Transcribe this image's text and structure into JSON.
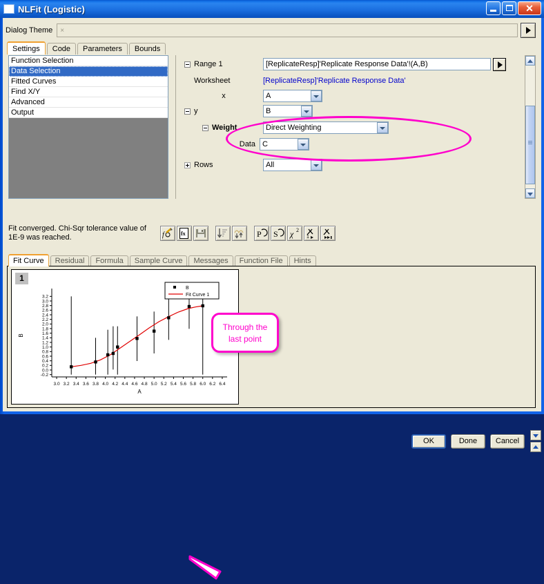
{
  "window": {
    "title": "NLFit (Logistic)",
    "minimize": "minimize",
    "maximize": "maximize",
    "close": "✕"
  },
  "theme": {
    "label": "Dialog Theme",
    "value": "",
    "placeholder": "×"
  },
  "top_tabs": [
    {
      "label": "Settings",
      "active": true
    },
    {
      "label": "Code",
      "active": false
    },
    {
      "label": "Parameters",
      "active": false
    },
    {
      "label": "Bounds",
      "active": false
    }
  ],
  "tree": {
    "items": [
      {
        "label": "Function Selection",
        "selected": false
      },
      {
        "label": "Data Selection",
        "selected": true
      },
      {
        "label": "Fitted Curves",
        "selected": false
      },
      {
        "label": "Find X/Y",
        "selected": false
      },
      {
        "label": "Advanced",
        "selected": false
      },
      {
        "label": "Output",
        "selected": false
      }
    ]
  },
  "settings": {
    "range_label": "Range 1",
    "range_value": "[ReplicateResp]'Replicate Response Data'!(A,B)",
    "worksheet_label": "Worksheet",
    "worksheet_value": "[ReplicateResp]'Replicate Response Data'",
    "x_label": "x",
    "x_value": "A",
    "y_label": "y",
    "y_value": "B",
    "weight_label": "Weight",
    "weight_value": "Direct Weighting",
    "data_label": "Data",
    "data_value": "C",
    "rows_label": "Rows",
    "rows_value": "All"
  },
  "status": {
    "text": "Fit converged. Chi-Sqr tolerance value of 1E-9 was reached."
  },
  "toolbar": {
    "buttons": [
      {
        "name": "formula-edit-icon",
        "glyph": "fℒ"
      },
      {
        "name": "function-file-icon",
        "glyph": "fx"
      },
      {
        "name": "save-icon",
        "glyph": "Ὃe"
      },
      {
        "name": "sort-descending-icon",
        "glyph": "↓"
      },
      {
        "name": "fit-peaks-icon",
        "glyph": "⇅"
      },
      {
        "name": "initialize-parameters-icon",
        "glyph": "P"
      },
      {
        "name": "simulate-curve-icon",
        "glyph": "S"
      },
      {
        "name": "chi-square-icon",
        "glyph": "χ²"
      },
      {
        "name": "one-iteration-icon",
        "glyph": "1▸"
      },
      {
        "name": "fit-until-converged-icon",
        "glyph": "▸▸"
      }
    ]
  },
  "dialog_buttons": {
    "ok": "OK",
    "done": "Done",
    "cancel": "Cancel"
  },
  "bottom_tabs": [
    {
      "label": "Fit Curve",
      "active": true
    },
    {
      "label": "Residual",
      "active": false
    },
    {
      "label": "Formula",
      "active": false
    },
    {
      "label": "Sample Curve",
      "active": false
    },
    {
      "label": "Messages",
      "active": false
    },
    {
      "label": "Function File",
      "active": false
    },
    {
      "label": "Hints",
      "active": false
    }
  ],
  "plot": {
    "layer_number": "1",
    "callout_text_line1": "Through the",
    "callout_text_line2": "last point"
  },
  "colors": {
    "accent_magenta": "#ff00cc",
    "fit_curve_red": "#e00000",
    "link_blue": "#0000cc",
    "selection_blue": "#316ac5",
    "dialog_face": "#ece9d8"
  },
  "chart_data": {
    "type": "scatter",
    "title": "",
    "xlabel": "A",
    "ylabel": "B",
    "xlim": [
      2.9,
      6.5
    ],
    "ylim": [
      -0.3,
      3.3
    ],
    "xticks": [
      3.0,
      3.2,
      3.4,
      3.6,
      3.8,
      4.0,
      4.2,
      4.4,
      4.6,
      4.8,
      5.0,
      5.2,
      5.4,
      5.6,
      5.8,
      6.0,
      6.2,
      6.4
    ],
    "yticks": [
      -0.2,
      0.0,
      0.2,
      0.4,
      0.6,
      0.8,
      1.0,
      1.2,
      1.4,
      1.6,
      1.8,
      2.0,
      2.2,
      2.4,
      2.6,
      2.8,
      3.0,
      3.2
    ],
    "grid": false,
    "legend_position": "top-right",
    "legend": [
      {
        "label": "B",
        "marker": "square",
        "color": "#000000"
      },
      {
        "label": "Fit Curve 1",
        "marker": "line",
        "color": "#e00000"
      }
    ],
    "series": [
      {
        "name": "B",
        "marker": "square",
        "color": "#000000",
        "points": [
          {
            "x": 3.3,
            "y": 0.14,
            "err_low": -0.2,
            "err_high": 3.2
          },
          {
            "x": 3.8,
            "y": 0.35,
            "err_low": -0.2,
            "err_high": 1.4
          },
          {
            "x": 4.05,
            "y": 0.66,
            "err_low": -0.2,
            "err_high": 1.75
          },
          {
            "x": 4.16,
            "y": 0.72,
            "err_low": 0.02,
            "err_high": 1.9
          },
          {
            "x": 4.25,
            "y": 1.0,
            "err_low": -0.2,
            "err_high": 1.9
          },
          {
            "x": 4.65,
            "y": 1.37,
            "err_low": 0.39,
            "err_high": 2.33
          },
          {
            "x": 5.0,
            "y": 1.69,
            "err_low": 0.72,
            "err_high": 2.54
          },
          {
            "x": 5.3,
            "y": 2.27,
            "err_low": 1.31,
            "err_high": 3.1
          },
          {
            "x": 5.72,
            "y": 2.76,
            "err_low": 1.79,
            "err_high": 3.17
          },
          {
            "x": 6.0,
            "y": 2.79,
            "err_low": -0.2,
            "err_high": 3.25
          }
        ]
      },
      {
        "name": "Fit Curve 1",
        "marker": "line",
        "color": "#e00000",
        "curve": [
          {
            "x": 3.3,
            "y": 0.14
          },
          {
            "x": 3.5,
            "y": 0.2
          },
          {
            "x": 3.7,
            "y": 0.29
          },
          {
            "x": 3.9,
            "y": 0.44
          },
          {
            "x": 4.1,
            "y": 0.66
          },
          {
            "x": 4.3,
            "y": 0.95
          },
          {
            "x": 4.5,
            "y": 1.24
          },
          {
            "x": 4.7,
            "y": 1.53
          },
          {
            "x": 4.9,
            "y": 1.83
          },
          {
            "x": 5.1,
            "y": 2.1
          },
          {
            "x": 5.3,
            "y": 2.32
          },
          {
            "x": 5.5,
            "y": 2.52
          },
          {
            "x": 5.7,
            "y": 2.67
          },
          {
            "x": 5.85,
            "y": 2.74
          },
          {
            "x": 6.0,
            "y": 2.79
          }
        ]
      }
    ]
  }
}
